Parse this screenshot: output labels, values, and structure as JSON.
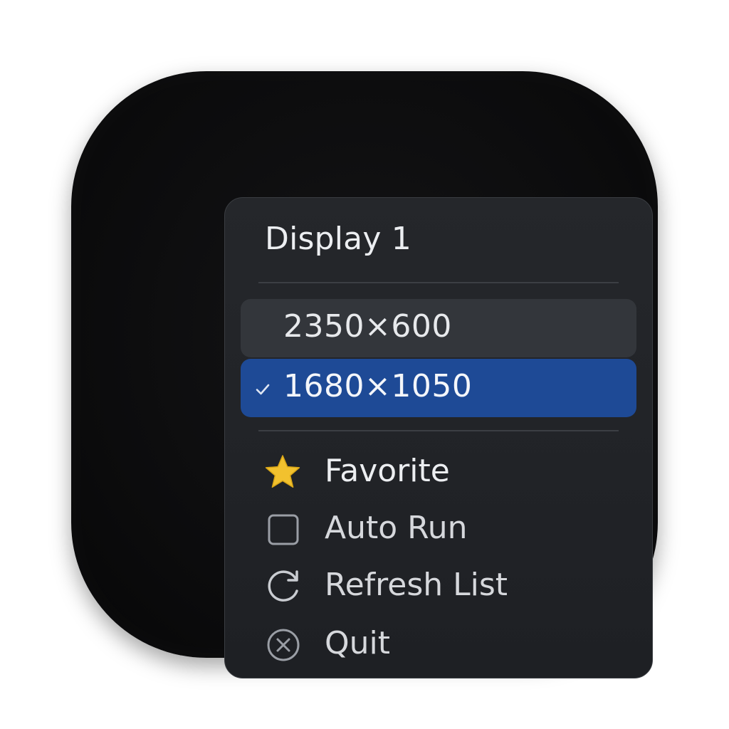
{
  "menu": {
    "title": "Display 1",
    "resolutions": [
      {
        "label": "2350×600",
        "state": "hover",
        "checked": false
      },
      {
        "label": "1680×1050",
        "state": "selected",
        "checked": true
      }
    ],
    "actions": [
      {
        "label": "Favorite",
        "icon": "star-icon",
        "icon_color": "#f2c12e"
      },
      {
        "label": "Auto Run",
        "icon": "checkbox-icon"
      },
      {
        "label": "Refresh List",
        "icon": "refresh-icon"
      },
      {
        "label": "Quit",
        "icon": "close-circle-icon"
      }
    ]
  },
  "colors": {
    "selection": "#1e4a96",
    "hover": "#33363b",
    "star": "#f2c12e"
  }
}
